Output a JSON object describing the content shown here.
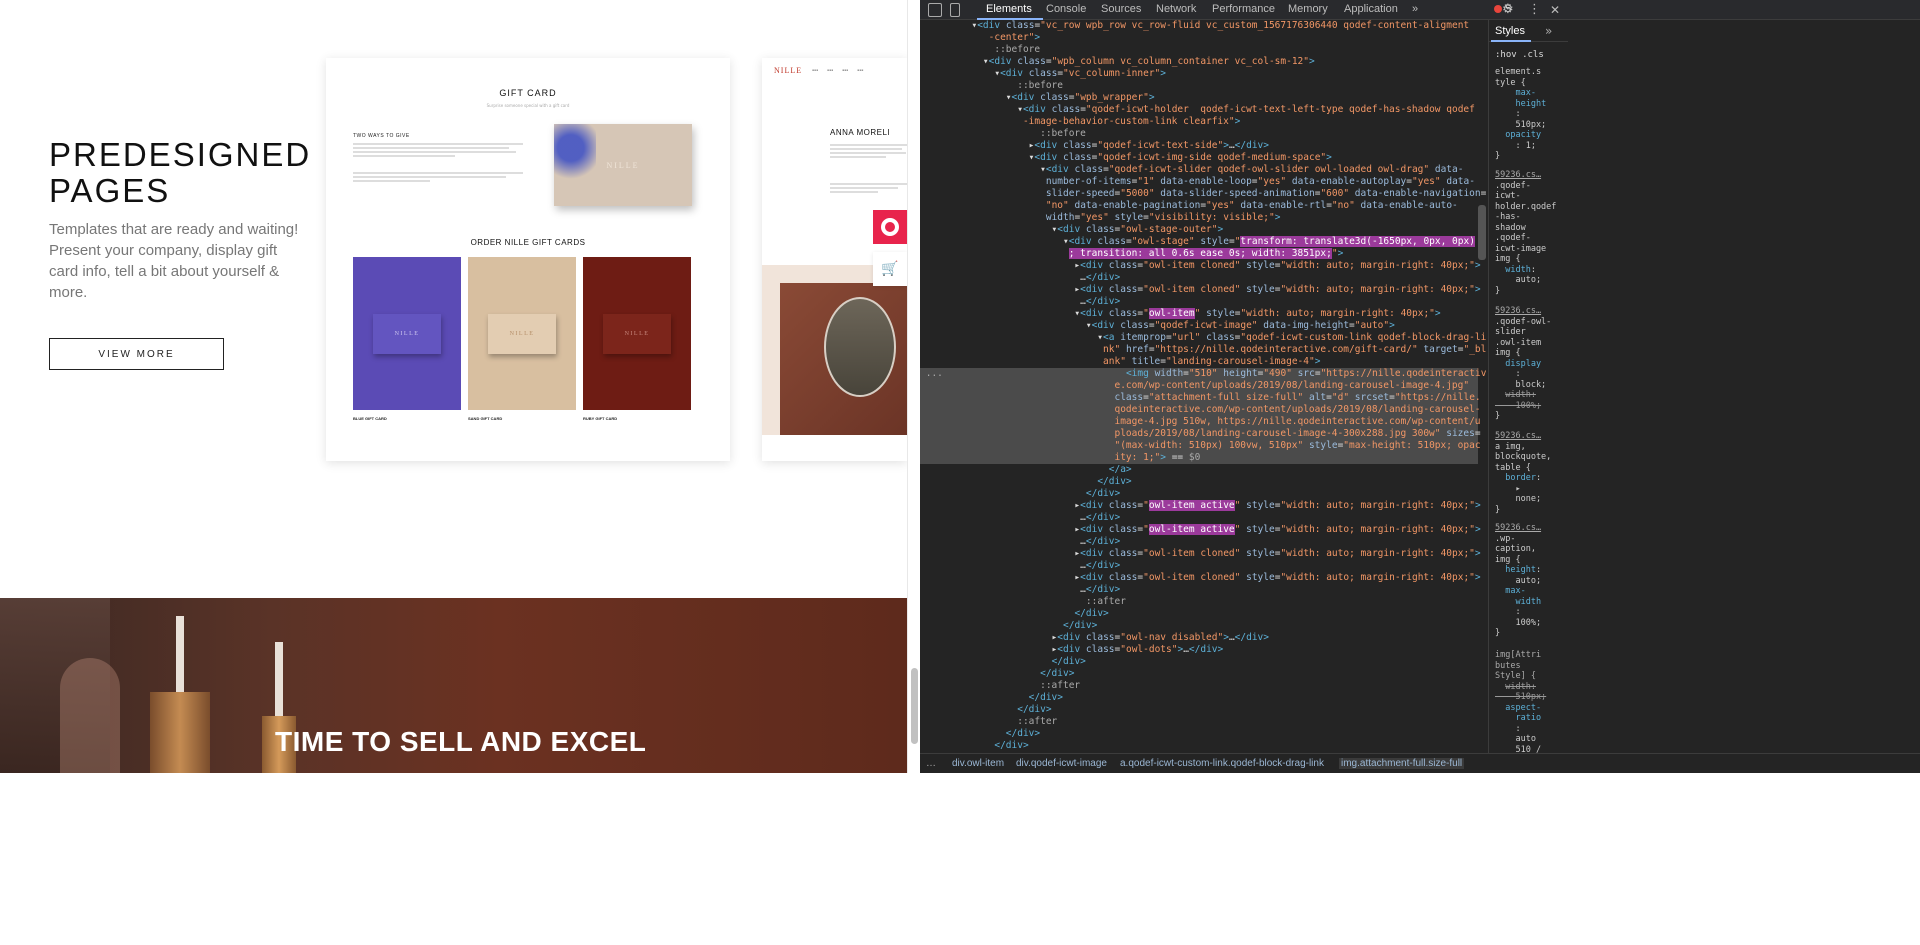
{
  "page": {
    "heading_line1": "PREDESIGNED",
    "heading_line2": "PAGES",
    "description": "Templates that are ready and waiting! Present your company, display gift card info, tell a bit about yourself & more.",
    "button": "VIEW MORE",
    "hero_title": "TIME TO SELL AND EXCEL"
  },
  "gift_card_page": {
    "title": "GIFT CARD",
    "subtitle": "Surprise someone special with a gift card",
    "ways_title": "TWO WAYS TO GIVE",
    "box_brand": "NILLE",
    "order_title": "ORDER NILLE GIFT CARDS",
    "products": [
      {
        "brand": "NILLE",
        "name": "BLUE GIFT CARD",
        "color": "#5b4bb5",
        "box": "#6355c0",
        "text": "#cfc8f0"
      },
      {
        "brand": "NILLE",
        "name": "SAND GIFT CARD",
        "color": "#d8bfa0",
        "box": "#e3cdb2",
        "text": "#b48d67"
      },
      {
        "brand": "NILLE",
        "name": "RUBY GIFT CARD",
        "color": "#6e1c14",
        "box": "#7c251b",
        "text": "#c98a80"
      }
    ]
  },
  "about_page": {
    "logo": "NILLE",
    "name": "ANNA MORELI"
  },
  "devtools": {
    "tabs": [
      "Elements",
      "Console",
      "Sources",
      "Network",
      "Performance",
      "Memory",
      "Application"
    ],
    "more": "»",
    "error_count": "5",
    "styles_tab": "Styles",
    "styles_more": "»",
    "filter": ":hov .cls",
    "breadcrumbs": [
      "div.owl-item",
      "div.qodef-icwt-image",
      "a.qodef-icwt-custom-link.qodef-block-drag-link",
      "img.attachment-full.size-full"
    ]
  },
  "colors": {
    "accent": "#e8244c",
    "devtools_bg": "#242424",
    "selection": "#4b4b4b",
    "highlight": "#9b3a9b"
  }
}
